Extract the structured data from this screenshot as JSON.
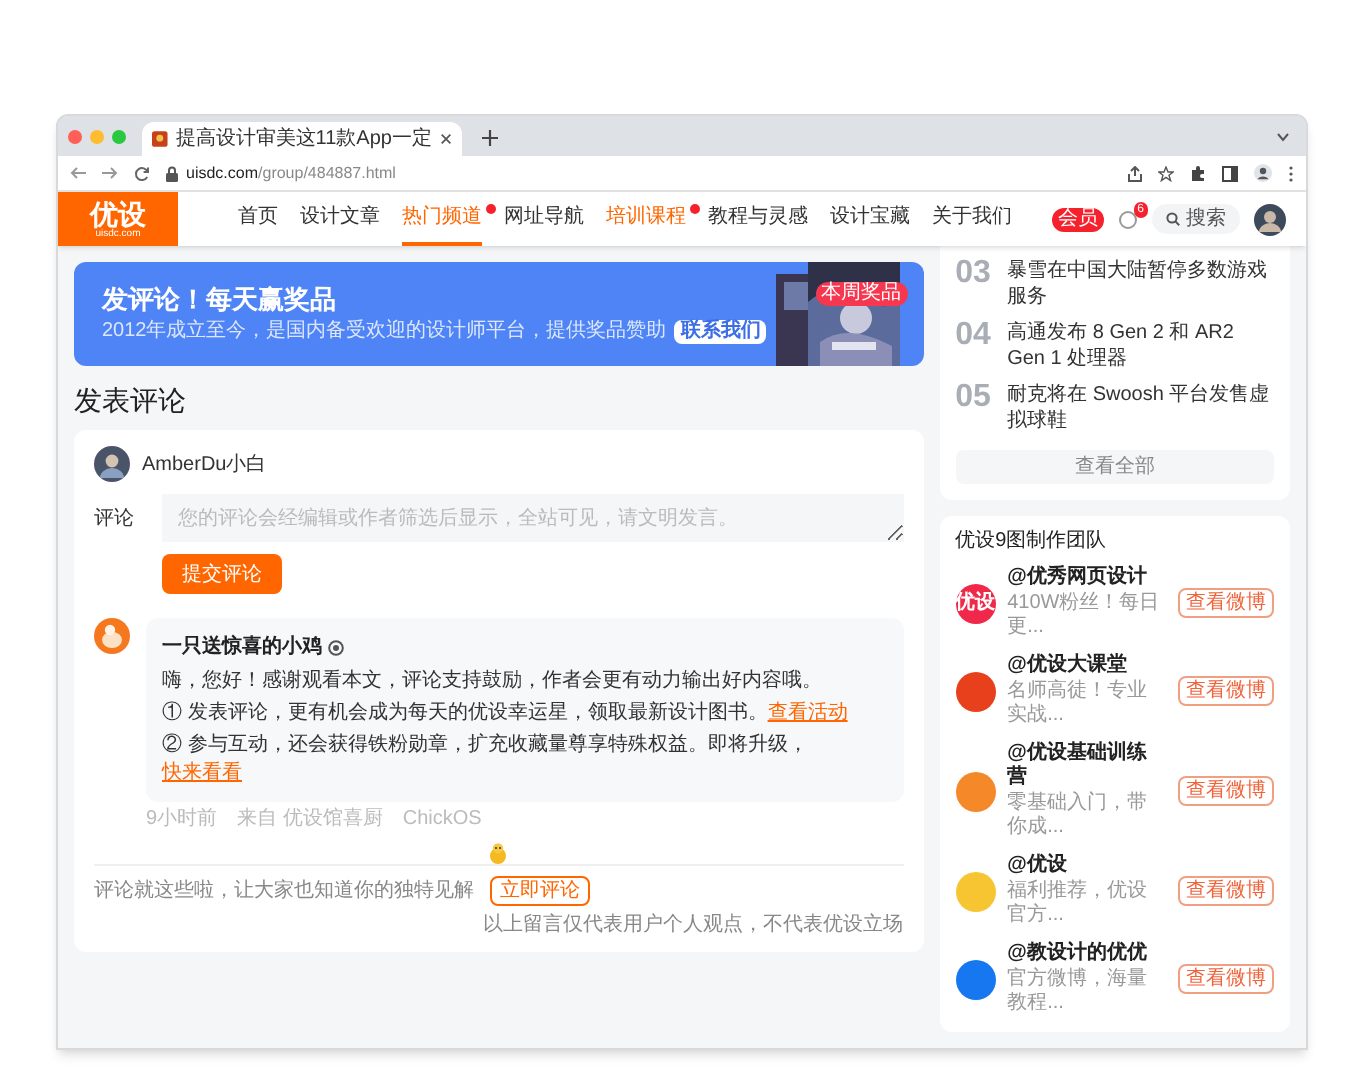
{
  "browser": {
    "tab_title": "提高设计审美这11款App一定",
    "url_host": "uisdc.com",
    "url_path": "/group/484887.html"
  },
  "site_header": {
    "logo": "优设",
    "logo_sub": "uisdc.com",
    "nav": [
      {
        "label": "首页",
        "selected": false,
        "highlighted": false,
        "badge": false
      },
      {
        "label": "设计文章",
        "selected": false,
        "highlighted": false,
        "badge": false
      },
      {
        "label": "热门频道",
        "selected": true,
        "highlighted": true,
        "badge": true
      },
      {
        "label": "网址导航",
        "selected": false,
        "highlighted": false,
        "badge": false
      },
      {
        "label": "培训课程",
        "selected": false,
        "highlighted": true,
        "badge": true
      },
      {
        "label": "教程与灵感",
        "selected": false,
        "highlighted": false,
        "badge": false
      },
      {
        "label": "设计宝藏",
        "selected": false,
        "highlighted": false,
        "badge": false
      },
      {
        "label": "关于我们",
        "selected": false,
        "highlighted": false,
        "badge": false
      }
    ],
    "vip_badge": "会员",
    "notification_count": "6",
    "search_label": "搜索"
  },
  "banner": {
    "title": "发评论！每天赢奖品",
    "subtitle": "2012年成立至今，是国内备受欢迎的设计师平台，提供奖品赞助",
    "button": "联系我们",
    "prize_tag": "本周奖品"
  },
  "comment_section": {
    "heading": "发表评论",
    "user": "AmberDu小白",
    "field_label": "评论",
    "placeholder": "您的评论会经编辑或作者筛选后显示，全站可见，请文明发言。",
    "submit": "提交评论",
    "comment": {
      "author": "一只送惊喜的小鸡",
      "intro": "嗨，您好！感谢观看本文，评论支持鼓励，作者会更有动力输出好内容哦。",
      "lines": [
        {
          "text": "① 发表评论，更有机会成为每天的优设幸运星，领取最新设计图书。",
          "link": "查看活动"
        },
        {
          "text": "② 参与互动，还会获得铁粉勋章，扩充收藏量尊享特殊权益。即将升级，",
          "link": "快来看看"
        }
      ],
      "meta": [
        "9小时前",
        "来自 优设馆喜厨",
        "ChickOS"
      ]
    },
    "footer_prompt": "评论就这些啦，让大家也知道你的独特见解",
    "footer_button": "立即评论",
    "disclaimer": "以上留言仅代表用户个人观点，不代表优设立场"
  },
  "sidebar": {
    "news": [
      {
        "rank": "03",
        "title": "暴雪在中国大陆暂停多数游戏服务"
      },
      {
        "rank": "04",
        "title": "高通发布 8 Gen 2 和 AR2 Gen 1 处理器"
      },
      {
        "rank": "05",
        "title": "耐克将在 Swoosh 平台发售虚拟球鞋"
      }
    ],
    "view_all": "查看全部",
    "team": {
      "title": "优设9图制作团队",
      "accounts": [
        {
          "name": "@优秀网页设计",
          "desc": "410W粉丝！每日更...",
          "button": "查看微博",
          "color": "#f0284a",
          "avatar_text": "优设"
        },
        {
          "name": "@优设大课堂",
          "desc": "名师高徒！专业实战...",
          "button": "查看微博",
          "color": "#e8401c"
        },
        {
          "name": "@优设基础训练营",
          "desc": "零基础入门，带你成...",
          "button": "查看微博",
          "color": "#f5892a"
        },
        {
          "name": "@优设",
          "desc": "福利推荐，优设官方...",
          "button": "查看微博",
          "color": "#f7c531"
        },
        {
          "name": "@教设计的优优",
          "desc": "官方微博，海量教程...",
          "button": "查看微博",
          "color": "#1677f0"
        }
      ]
    }
  }
}
